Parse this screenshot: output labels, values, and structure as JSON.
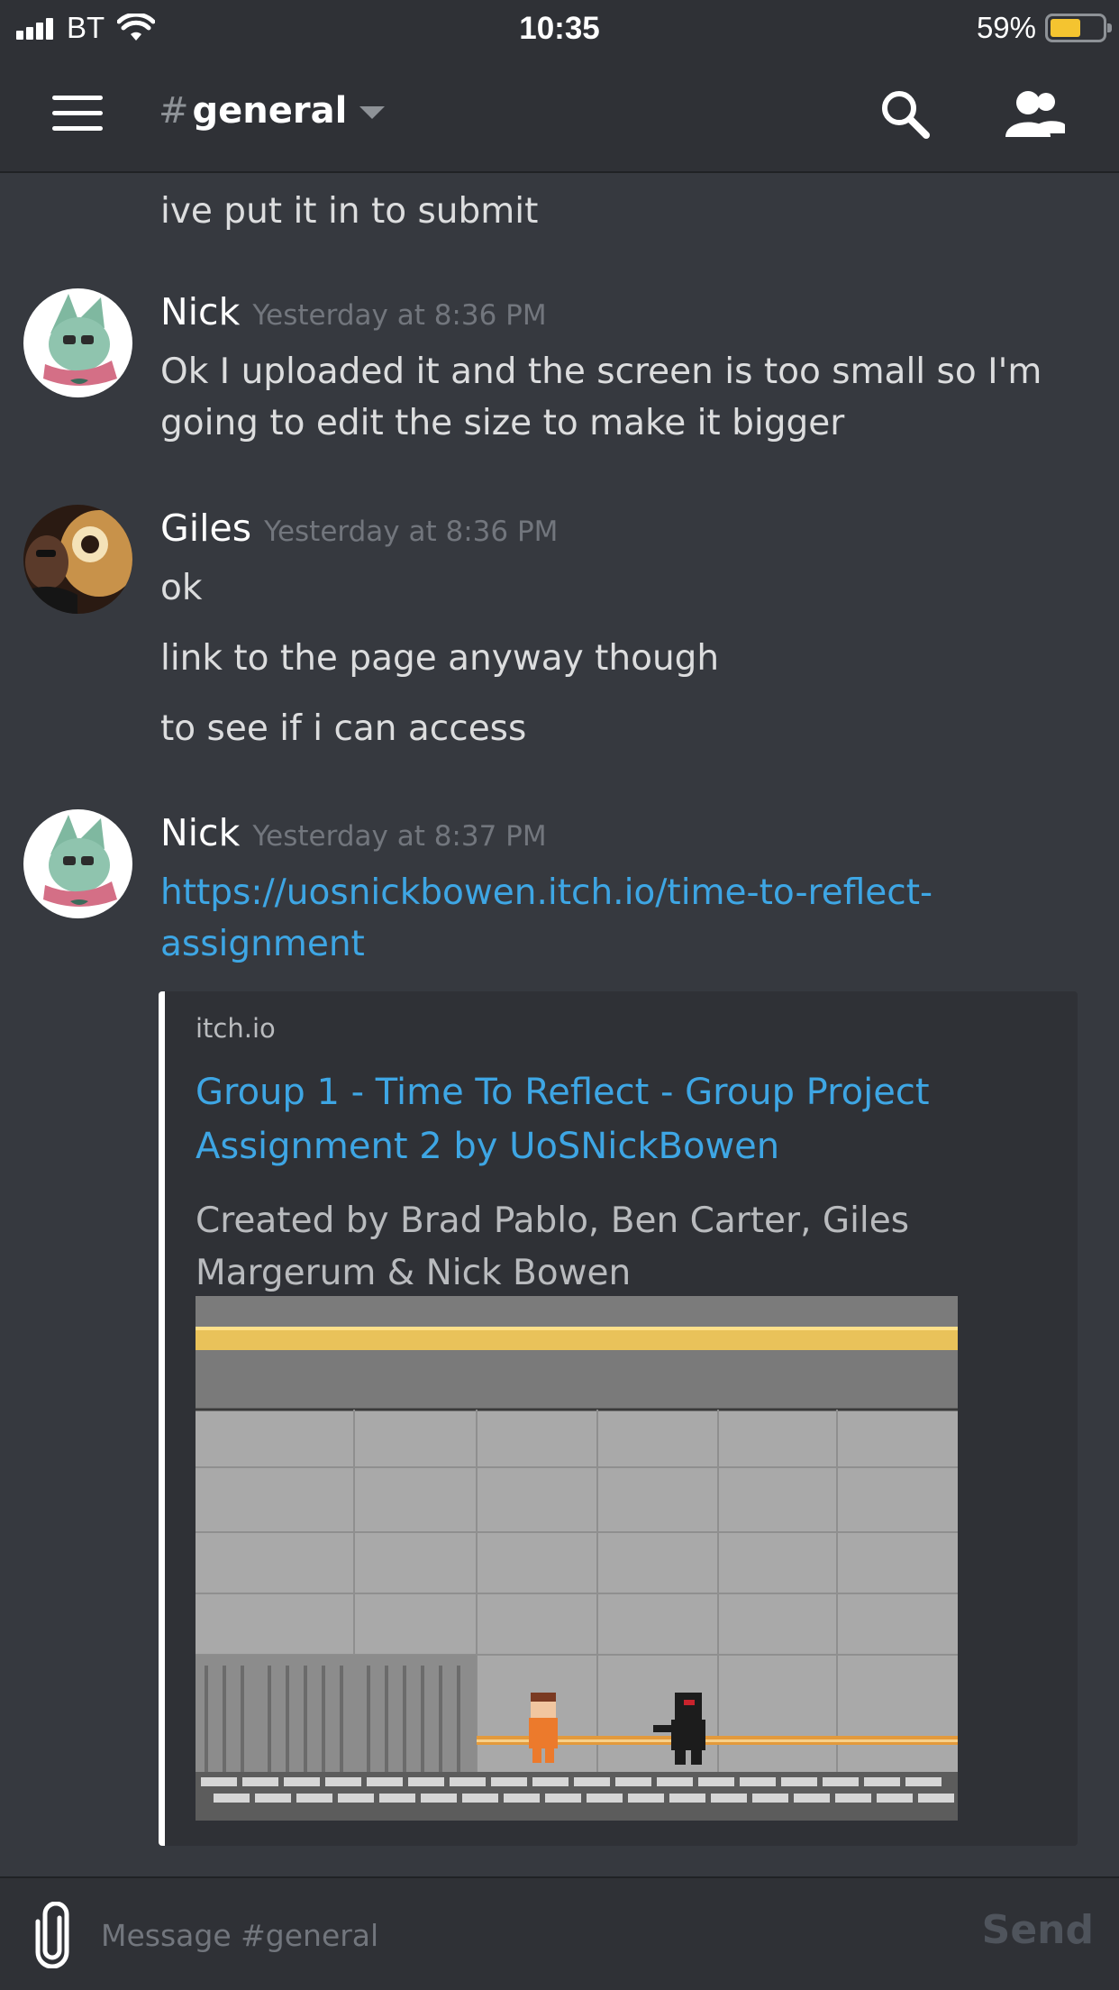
{
  "status_bar": {
    "carrier": "BT",
    "time": "10:35",
    "battery_percent": "59%",
    "battery_level": 0.59
  },
  "header": {
    "channel_hash": "#",
    "channel_name": "general",
    "icons": [
      "menu-icon",
      "search-icon",
      "members-icon"
    ]
  },
  "messages": [
    {
      "continuation": true,
      "lines": [
        "ive put it in to submit"
      ]
    },
    {
      "author": "Nick",
      "timestamp": "Yesterday at 8:36 PM",
      "lines": [
        "Ok I uploaded it and the screen is too small so I'm going to edit the size to make it bigger"
      ]
    },
    {
      "author": "Giles",
      "timestamp": "Yesterday at 8:36 PM",
      "lines": [
        "ok",
        "link to the page anyway though",
        "to see if i can access"
      ]
    },
    {
      "author": "Nick",
      "timestamp": "Yesterday at 8:37 PM",
      "link": "https://uosnickbowen.itch.io/time-to-reflect-assignment"
    }
  ],
  "embed": {
    "provider": "itch.io",
    "title": "Group 1 - Time To Reflect - Group Project Assignment 2 by UoSNickBowen",
    "description": "Created by Brad Pablo, Ben Carter, Giles Margerum & Nick Bowen"
  },
  "composer": {
    "placeholder": "Message #general",
    "send_label": "Send"
  },
  "colors": {
    "background": "#36393f",
    "chrome": "#2f3136",
    "link": "#3ea6e4",
    "muted": "#72767d",
    "battery": "#f4c430"
  }
}
